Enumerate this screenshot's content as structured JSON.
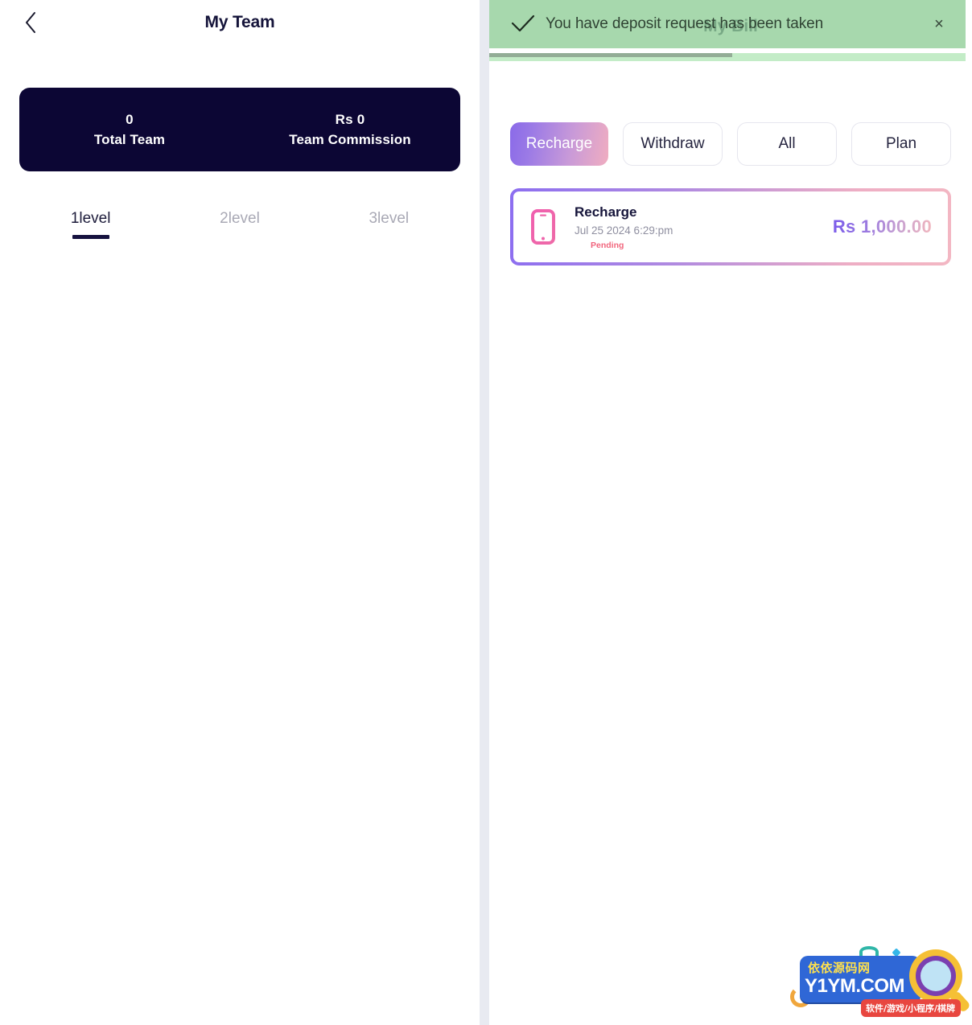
{
  "left": {
    "header": {
      "title": "My Team",
      "back_icon": "chevron-left-icon"
    },
    "stats": [
      {
        "value": "0",
        "label": "Total Team"
      },
      {
        "value": "Rs 0",
        "label": "Team Commission"
      }
    ],
    "level_tabs": [
      {
        "label": "1level",
        "active": true
      },
      {
        "label": "2level",
        "active": false
      },
      {
        "label": "3level",
        "active": false
      }
    ]
  },
  "right": {
    "header": {
      "title": "My Bill"
    },
    "toast": {
      "message": "You have deposit request has been taken",
      "check_icon": "check-icon",
      "close_icon": "close-icon",
      "close_label": "×",
      "progress_percent": 51,
      "background_color": "#91ce99",
      "progress_color": "#93ad96"
    },
    "filters": [
      {
        "label": "Recharge",
        "active": true
      },
      {
        "label": "Withdraw",
        "active": false
      },
      {
        "label": "All",
        "active": false
      },
      {
        "label": "Plan",
        "active": false
      }
    ],
    "transactions": [
      {
        "icon": "mobile-phone-icon",
        "title": "Recharge",
        "date": "Jul 25 2024 6:29:pm",
        "status": "Pending",
        "amount": "Rs 1,000.00"
      }
    ]
  },
  "watermark": {
    "cn_name": "依依源码网",
    "domain": "Y1YM.COM",
    "tags": "软件/游戏/小程序/棋牌"
  },
  "colors": {
    "dark_navy": "#0c0634",
    "accent_purple": "#8a6ae8",
    "accent_pink": "#f0adc0",
    "status_pending": "#f0607a",
    "toast_green": "#91ce99"
  }
}
